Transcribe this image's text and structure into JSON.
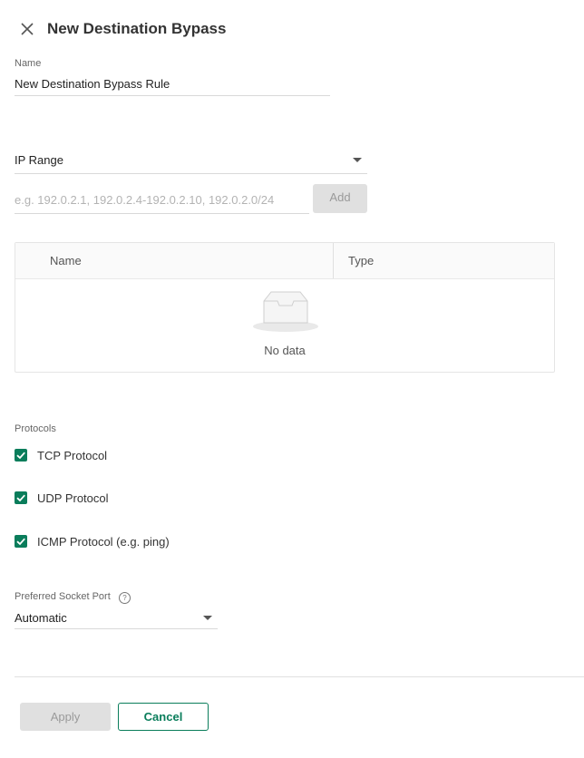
{
  "dialog": {
    "title": "New Destination Bypass",
    "close_icon": "close-icon"
  },
  "name_field": {
    "label": "Name",
    "value": "New Destination Bypass Rule"
  },
  "type_select": {
    "value": "IP Range",
    "icon": "caret-down-icon"
  },
  "address_input": {
    "placeholder": "e.g. 192.0.2.1, 192.0.2.4-192.0.2.10, 192.0.2.0/24",
    "add_label": "Add"
  },
  "table": {
    "columns": [
      "Name",
      "Type"
    ],
    "empty_text": "No data",
    "empty_icon": "inbox-icon"
  },
  "protocols": {
    "label": "Protocols",
    "items": [
      {
        "label": "TCP Protocol",
        "checked": true
      },
      {
        "label": "UDP Protocol",
        "checked": true
      },
      {
        "label": "ICMP Protocol (e.g. ping)",
        "checked": true
      }
    ]
  },
  "socket_port": {
    "label": "Preferred Socket Port",
    "help_icon": "help-icon",
    "value": "Automatic"
  },
  "footer": {
    "apply_label": "Apply",
    "cancel_label": "Cancel"
  },
  "colors": {
    "accent": "#0a7d5b",
    "disabled_bg": "#e0e0e0"
  }
}
